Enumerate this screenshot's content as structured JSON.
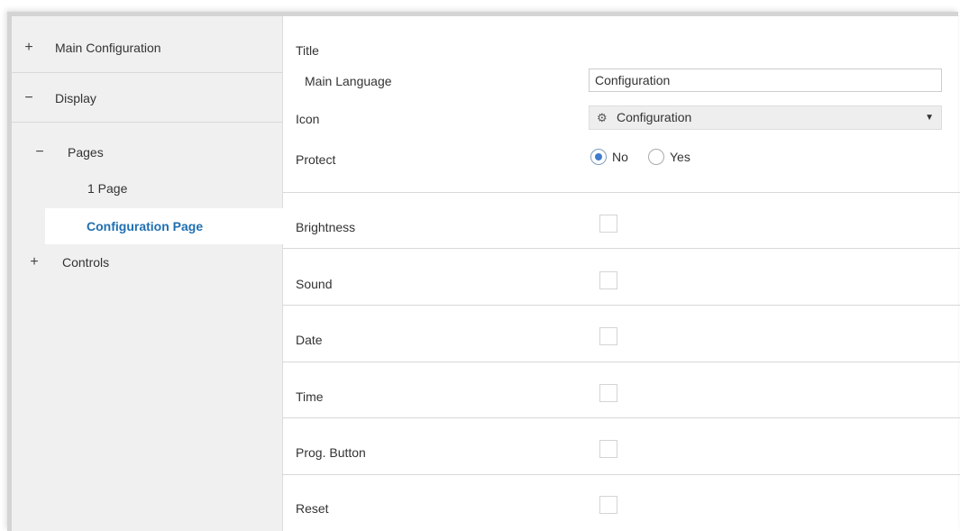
{
  "sidebar": {
    "main_configuration": {
      "sign": "+",
      "label": "Main Configuration"
    },
    "display": {
      "sign": "−",
      "label": "Display"
    },
    "pages": {
      "sign": "−",
      "label": "Pages"
    },
    "page_1": {
      "label": "1 Page"
    },
    "configuration_page": {
      "label": "Configuration Page"
    },
    "controls": {
      "sign": "+",
      "label": "Controls"
    }
  },
  "content": {
    "title_label": "Title",
    "main_language_label": "Main Language",
    "main_language_value": "Configuration",
    "icon_label": "Icon",
    "icon_select": {
      "icon": "gear-icon",
      "icon_glyph": "⚙",
      "value": "Configuration",
      "arrow": "▼"
    },
    "protect_label": "Protect",
    "protect_options": [
      {
        "label": "No",
        "checked": true
      },
      {
        "label": "Yes",
        "checked": false
      }
    ],
    "brightness_label": "Brightness",
    "sound_label": "Sound",
    "date_label": "Date",
    "time_label": "Time",
    "prog_button_label": "Prog. Button",
    "reset_label": "Reset"
  },
  "colors": {
    "accent": "#1f6fb2",
    "sidebar_bg": "#f0f0f0",
    "radio_dot": "#3f7ccf"
  }
}
